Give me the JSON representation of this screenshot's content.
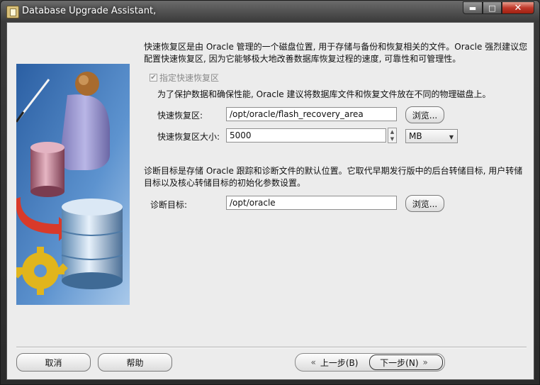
{
  "window": {
    "title": "Database Upgrade Assistant,"
  },
  "titlebar_buttons": {
    "minimize": "▬",
    "maximize": "□",
    "close": "✕"
  },
  "flash": {
    "intro_line1": "快速恢复区是由 Oracle 管理的一个磁盘位置, 用于存储与备份和恢复相关的文件。Oracle 强烈建议您",
    "intro_line2": "配置快速恢复区, 因为它能够极大地改善数据库恢复过程的速度, 可靠性和可管理性。",
    "checkbox_label": "指定快速恢复区",
    "checkbox_checked": true,
    "note": "为了保护数据和确保性能, Oracle 建议将数据库文件和恢复文件放在不同的物理磁盘上。",
    "area_label": "快速恢复区:",
    "area_value": "/opt/oracle/flash_recovery_area",
    "browse_label": "浏览...",
    "size_label": "快速恢复区大小:",
    "size_value": "5000",
    "unit_value": "MB"
  },
  "diag": {
    "intro_line1": "诊断目标是存储 Oracle 跟踪和诊断文件的默认位置。它取代早期发行版中的后台转储目标, 用户转储",
    "intro_line2": "目标以及核心转储目标的初始化参数设置。",
    "label": "诊断目标:",
    "value": "/opt/oracle",
    "browse_label": "浏览..."
  },
  "footer": {
    "cancel": "取消",
    "help": "帮助",
    "back": "上一步(B)",
    "next": "下一步(N)"
  },
  "colors": {
    "accent": "#2f6fb0",
    "art_bg": "#3f76b8"
  }
}
